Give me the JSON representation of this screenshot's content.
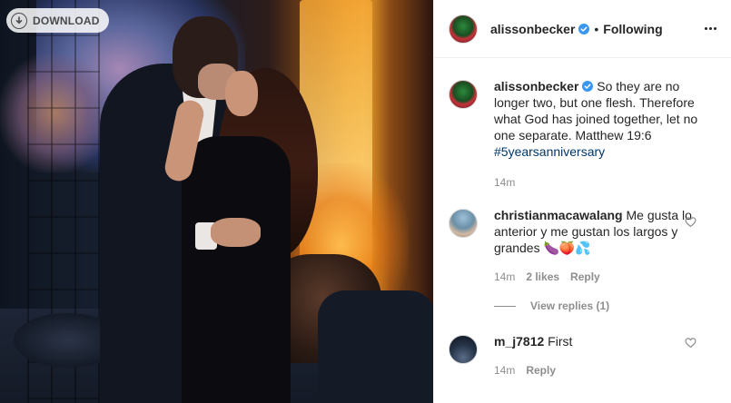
{
  "photo": {
    "download_label": "DOWNLOAD"
  },
  "header": {
    "username": "alissonbecker",
    "separator": "•",
    "following_label": "Following"
  },
  "caption": {
    "username": "alissonbecker",
    "text": " So they are no longer two, but one flesh. Therefore what God has joined together, let no one separate. Matthew 19:6 ",
    "hashtag": "#5yearsanniversary",
    "time": "14m"
  },
  "comments": [
    {
      "username": "christianmacawalang",
      "text": " Me gusta lo anterior y me gustan los largos y grandes 🍆🍑💦",
      "time": "14m",
      "likes": "2 likes",
      "reply_label": "Reply",
      "view_replies": "View replies (1)"
    },
    {
      "username": "m_j7812",
      "text": " First",
      "time": "14m",
      "reply_label": "Reply"
    }
  ],
  "colors": {
    "verified": "#3897f0",
    "hashtag": "#00376b",
    "meta": "#8e8e8e"
  }
}
